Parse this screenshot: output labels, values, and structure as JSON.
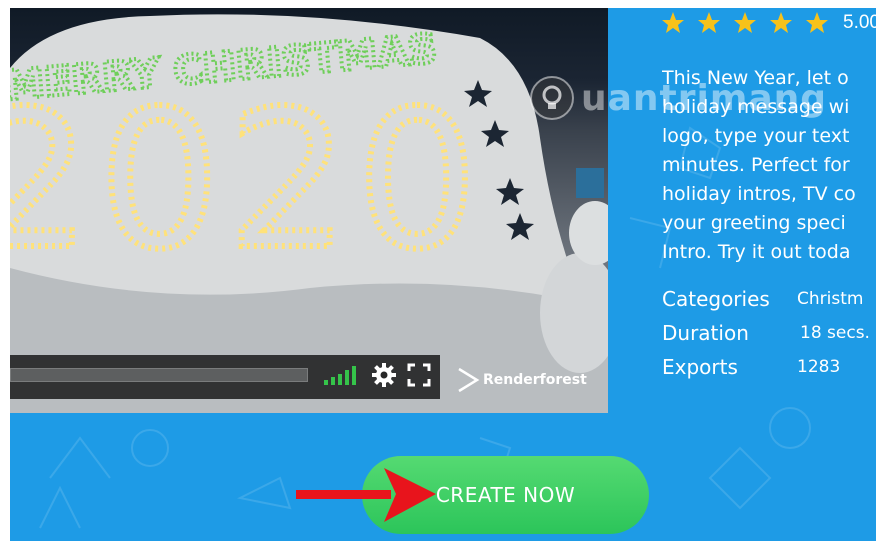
{
  "video": {
    "banner_top_text": "MERRY CHRISTMAS",
    "banner_year_text": "2020",
    "progress_fraction": 0.0,
    "brand_name": "Renderforest"
  },
  "watermark": {
    "text": "uantrimang"
  },
  "rating": {
    "stars": 5,
    "value_text": "5.00"
  },
  "description": {
    "lines": [
      "This New Year, let o",
      "holiday message wi",
      "logo, type your text",
      "minutes. Perfect for",
      "holiday intros, TV co",
      "your greeting speci",
      "Intro. Try it out toda"
    ]
  },
  "meta": {
    "categories_label": "Categories",
    "categories_value": "Christm",
    "duration_label": "Duration",
    "duration_value": "18 secs.",
    "exports_label": "Exports",
    "exports_value": "1283"
  },
  "cta": {
    "label": "CREATE NOW"
  },
  "colors": {
    "page_bg": "#1e9be6",
    "star": "#f7c21b",
    "cta": "#2ec95b",
    "arrow": "#e8141c",
    "volume_green": "#35c44a"
  }
}
